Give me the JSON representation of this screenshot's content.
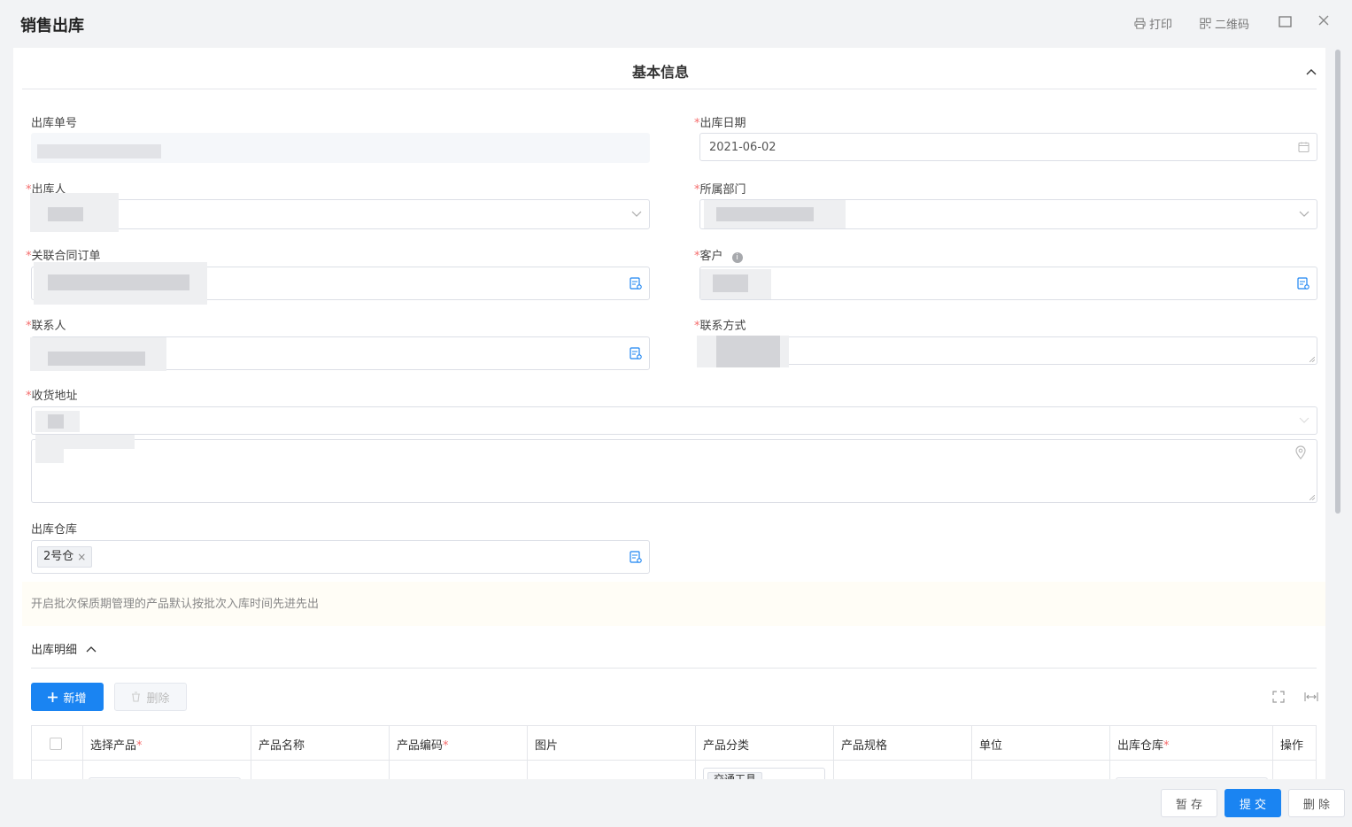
{
  "window": {
    "title": "销售出库",
    "print_label": "打印",
    "qr_label": "二维码"
  },
  "section": {
    "title": "基本信息"
  },
  "fields": {
    "order_no": {
      "label": "出库单号"
    },
    "out_date": {
      "label": "出库日期",
      "value": "2021-06-02"
    },
    "operator": {
      "label": "出库人"
    },
    "department": {
      "label": "所属部门"
    },
    "contract": {
      "label": "关联合同订单"
    },
    "customer": {
      "label": "客户"
    },
    "contact": {
      "label": "联系人"
    },
    "contact_method": {
      "label": "联系方式"
    },
    "address": {
      "label": "收货地址"
    },
    "warehouse": {
      "label": "出库仓库",
      "tag": "2号仓"
    }
  },
  "notice": "开启批次保质期管理的产品默认按批次入库时间先进先出",
  "detail": {
    "title": "出库明细",
    "add_label": "新增",
    "delete_label": "删除",
    "columns": [
      "选择产品",
      "产品名称",
      "产品编码",
      "图片",
      "产品分类",
      "产品规格",
      "单位",
      "出库仓库",
      "操作"
    ],
    "row_category": "交通工具"
  },
  "footer": {
    "save_label": "暂 存",
    "submit_label": "提 交",
    "delete_label": "删 除"
  },
  "colors": {
    "primary": "#1a84f2",
    "required": "#f56c6c",
    "notice_bg": "#fffdf6"
  }
}
